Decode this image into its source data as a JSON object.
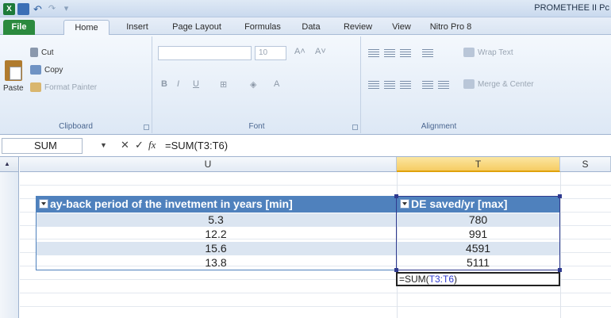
{
  "titlebar": {
    "app_title": "PROMETHEE II Pc"
  },
  "tabs": [
    "File",
    "Home",
    "Insert",
    "Page Layout",
    "Formulas",
    "Data",
    "Review",
    "View",
    "Nitro Pro 8"
  ],
  "ribbon": {
    "clipboard": {
      "paste": "Paste",
      "cut": "Cut",
      "copy": "Copy",
      "format_painter": "Format Painter",
      "label": "Clipboard"
    },
    "font": {
      "size": "10",
      "label": "Font"
    },
    "alignment": {
      "wrap_text": "Wrap Text",
      "merge_center": "Merge & Center",
      "label": "Alignment"
    }
  },
  "formula_bar": {
    "name_box": "SUM",
    "fx": "fx",
    "formula": "=SUM(T3:T6)"
  },
  "columns": {
    "u": "U",
    "t": "T",
    "s": "S"
  },
  "table": {
    "headers": [
      "ay-back period of the invetment in years [min]",
      "DE saved/yr [max]"
    ],
    "rows": [
      [
        "5.3",
        "780"
      ],
      [
        "12.2",
        "991"
      ],
      [
        "15.6",
        "4591"
      ],
      [
        "13.8",
        "5111"
      ]
    ]
  },
  "edit_cell": {
    "prefix": "=SUM(",
    "ref": "T3:T6",
    "suffix": ")"
  },
  "colors": {
    "table_header": "#4f81bd",
    "band": "#dbe5f1",
    "selected_column": "#f6cc63",
    "file_tab": "#2b8a3e"
  }
}
